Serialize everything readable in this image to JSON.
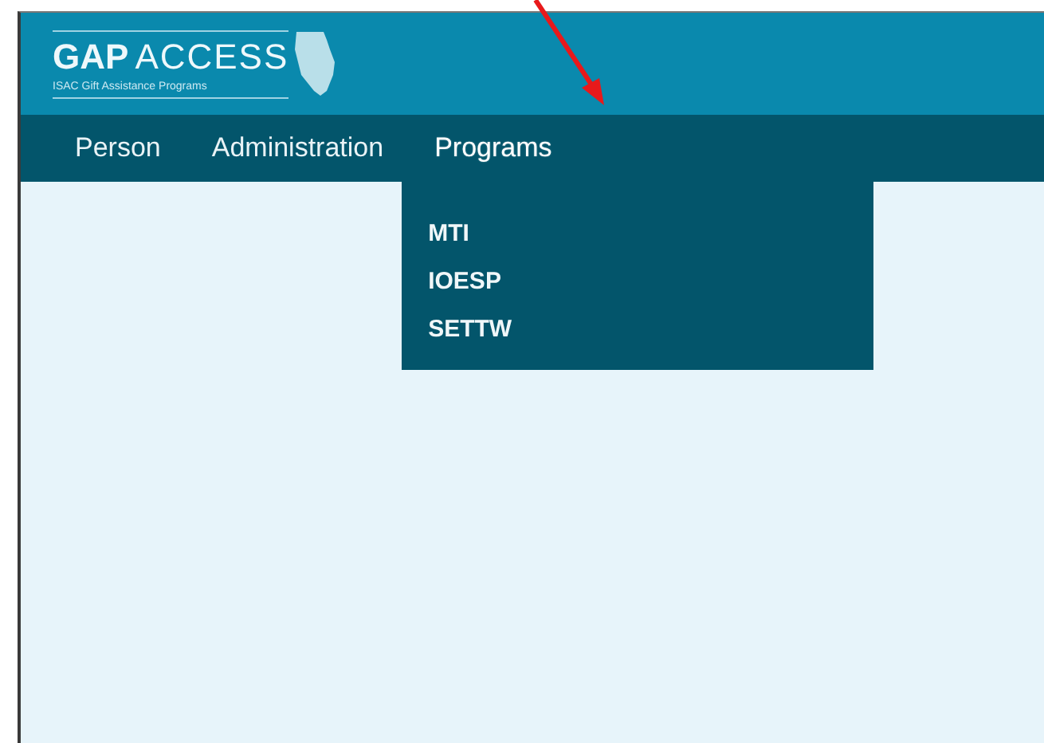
{
  "header": {
    "logo": {
      "brand_bold": "GAP",
      "brand_light": "ACCESS",
      "tagline": "ISAC Gift Assistance Programs"
    }
  },
  "nav": {
    "items": [
      {
        "label": "Person",
        "expanded": false
      },
      {
        "label": "Administration",
        "expanded": false
      },
      {
        "label": "Programs",
        "expanded": true,
        "children": [
          {
            "label": "MTI"
          },
          {
            "label": "IOESP"
          },
          {
            "label": "SETTW"
          }
        ]
      }
    ]
  },
  "annotation": {
    "kind": "arrow"
  }
}
